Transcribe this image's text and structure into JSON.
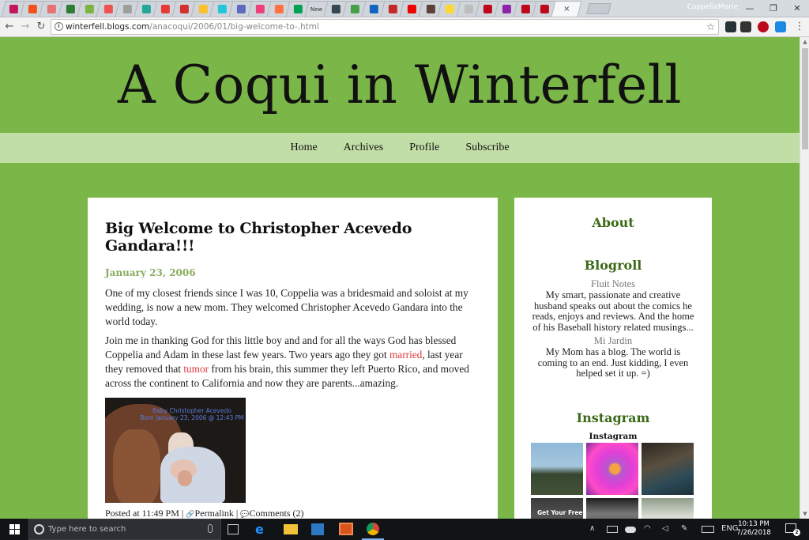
{
  "browser": {
    "profile_name": "CoppeliaMarie",
    "new_tab_label": "New",
    "url_host": "winterfell.blogs.com",
    "url_path": "/anacoqui/2006/01/big-welcome-to-.html",
    "info_glyph": "i",
    "minimize_glyph": "—",
    "restore_glyph": "❐",
    "close_glyph": "✕",
    "back_glyph": "←",
    "forward_glyph": "→",
    "reload_glyph": "↻",
    "star_glyph": "☆",
    "menu_glyph": "⋮",
    "tab_close_glyph": "×"
  },
  "site": {
    "title": "A Coqui in Winterfell",
    "nav": [
      "Home",
      "Archives",
      "Profile",
      "Subscribe"
    ],
    "accent_color": "#7ab648",
    "nav_bg_color": "#c2dea7",
    "link_color": "#e0393e"
  },
  "post": {
    "title": "Big Welcome to Christopher Acevedo Gandara!!!",
    "date": "January 23, 2006",
    "paragraph1": "One of my closest friends since I was 10, Coppelia was a bridesmaid and soloist at my wedding, is now a new mom. They welcomed Christopher Acevedo Gandara into the world today.",
    "p2_part1": "Join me in thanking God for this little boy and and for all the ways God has blessed Coppelia and Adam in these last few years. Two years ago they got ",
    "p2_link1": "married",
    "p2_part2": ", last year they removed that ",
    "p2_link2": "tumor",
    "p2_part3": " from his brain, this summer they left Puerto Rico, and moved across the continent to California and now they are parents...amazing.",
    "photo_caption_line1": "Baby Christopher Acevedo",
    "photo_caption_line2": "Born January 23, 2006 @ 12:43 PM",
    "footer_posted": "Posted at 11:49 PM",
    "footer_sep": "|",
    "footer_permalink": "Permalink",
    "footer_comments": "Comments (2)",
    "permalink_glyph": "🔗",
    "comment_glyph": "💬"
  },
  "sidebar": {
    "about_title": "About",
    "blogroll_title": "Blogroll",
    "blogroll": [
      {
        "name": "Fluit Notes",
        "desc": "My smart, passionate and creative husband speaks out about the comics he reads, enjoys and reviews. And the home of his Baseball history related musings..."
      },
      {
        "name": "Mi Jardin",
        "desc": "My Mom has a blog. The world is coming to an end. Just kidding, I even helped set it up. =)"
      }
    ],
    "instagram_title": "Instagram",
    "instagram_subtitle": "Instagram",
    "instagram_tile_text": "Get Your Free"
  },
  "taskbar": {
    "search_placeholder": "Type here to search",
    "language": "ENG",
    "time": "10:13 PM",
    "date": "7/26/2018",
    "notification_count": "2",
    "tray_up_glyph": "∧"
  }
}
